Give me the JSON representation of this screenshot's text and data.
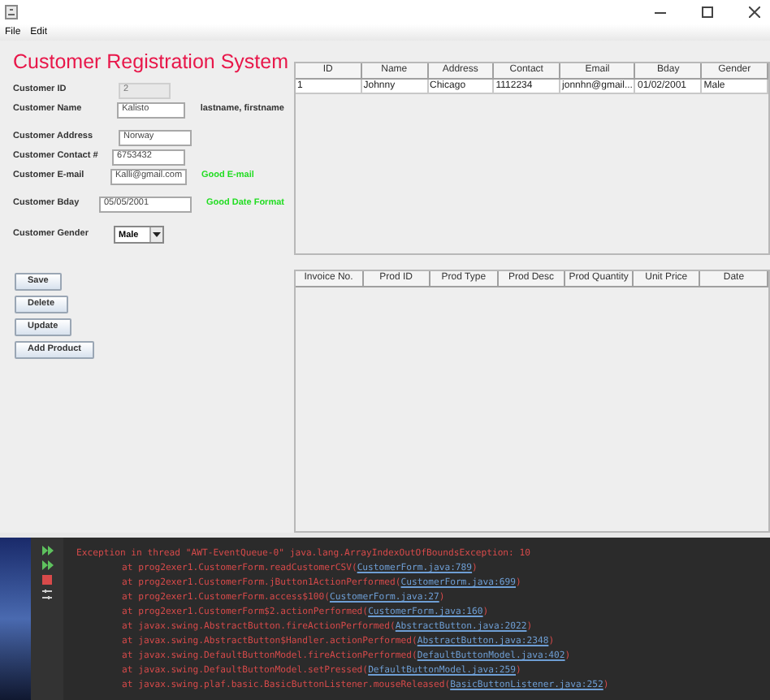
{
  "menu": [
    "File",
    "Edit"
  ],
  "title": "Customer Registration System",
  "fields": [
    {
      "label": "Customer ID",
      "value": "2",
      "disabled": true
    },
    {
      "label": "Customer Name",
      "value": "Kalisto",
      "disabled": false,
      "hint": "lastname, firstname",
      "kind": "note"
    },
    {
      "label": "Customer Address",
      "value": "Norway",
      "disabled": false
    },
    {
      "label": "Customer Contact #",
      "value": "6753432",
      "disabled": false
    },
    {
      "label": "Customer E-mail",
      "value": "Kalli@gmail.com",
      "disabled": false,
      "hint": "Good E-mail",
      "kind": "ok"
    },
    {
      "label": "Customer Bday",
      "value": "05/05/2001",
      "disabled": false,
      "hint": "Good Date Format",
      "kind": "ok"
    }
  ],
  "gender": {
    "label": "Customer Gender",
    "value": "Male"
  },
  "buttons": [
    "Save",
    "Delete",
    "Update",
    "Add Product"
  ],
  "customers_table": {
    "columns": [
      "ID",
      "Name",
      "Address",
      "Contact",
      "Email",
      "Bday",
      "Gender"
    ],
    "rows": [
      [
        "1",
        "Johnny",
        "Chicago",
        "1112234",
        "jonnhn@gmail...",
        "01/02/2001",
        "Male"
      ]
    ]
  },
  "products_table": {
    "columns": [
      "Invoice No.",
      "Prod ID",
      "Prod Type",
      "Prod Desc",
      "Prod Quantity",
      "Unit Price",
      "Date"
    ]
  },
  "console": [
    {
      "text": "Exception in thread \"AWT-EventQueue-0\" java.lang.ArrayIndexOutOfBoundsException: 10"
    },
    {
      "text": "at prog2exer1.CustomerForm.readCustomerCSV(",
      "link": "CustomerForm.java:789",
      "end": ")"
    },
    {
      "text": "at prog2exer1.CustomerForm.jButton1ActionPerformed(",
      "link": "CustomerForm.java:699",
      "end": ")"
    },
    {
      "text": "at prog2exer1.CustomerForm.access$100(",
      "link": "CustomerForm.java:27",
      "end": ")"
    },
    {
      "text": "at prog2exer1.CustomerForm$2.actionPerformed(",
      "link": "CustomerForm.java:160",
      "end": ")"
    },
    {
      "text": "at javax.swing.AbstractButton.fireActionPerformed(",
      "link": "AbstractButton.java:2022",
      "end": ")"
    },
    {
      "text": "at javax.swing.AbstractButton$Handler.actionPerformed(",
      "link": "AbstractButton.java:2348",
      "end": ")"
    },
    {
      "text": "at javax.swing.DefaultButtonModel.fireActionPerformed(",
      "link": "DefaultButtonModel.java:402",
      "end": ")"
    },
    {
      "text": "at javax.swing.DefaultButtonModel.setPressed(",
      "link": "DefaultButtonModel.java:259",
      "end": ")"
    },
    {
      "text": "at javax.swing.plaf.basic.BasicButtonListener.mouseReleased(",
      "link": "BasicButtonListener.java:252",
      "end": ")"
    }
  ]
}
